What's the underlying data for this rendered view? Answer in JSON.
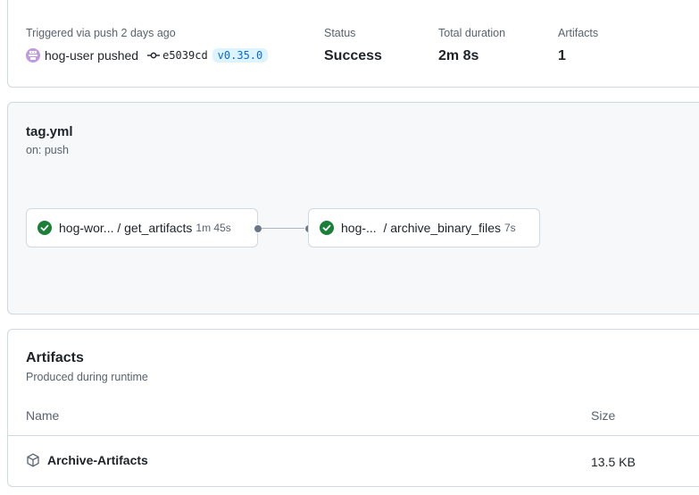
{
  "summary": {
    "trigger_label": "Triggered via push 2 days ago",
    "user": "hog-user",
    "action": "pushed",
    "commit_sha": "e5039cd",
    "tag": "v0.35.0",
    "status_label": "Status",
    "status_value": "Success",
    "duration_label": "Total duration",
    "duration_value": "2m 8s",
    "artifacts_label": "Artifacts",
    "artifacts_count": "1"
  },
  "workflow": {
    "file": "tag.yml",
    "trigger": "on: push",
    "jobs": [
      {
        "name": "hog-wor... / get_artifacts",
        "duration": "1m 45s",
        "status": "success"
      },
      {
        "name": "hog-...  / archive_binary_files",
        "duration": "7s",
        "status": "success"
      }
    ]
  },
  "artifacts": {
    "title": "Artifacts",
    "subtitle": "Produced during runtime",
    "columns": [
      "Name",
      "Size"
    ],
    "rows": [
      {
        "name": "Archive-Artifacts",
        "size": "13.5 KB",
        "icon": "package-icon"
      }
    ]
  },
  "colors": {
    "success": "#1a7f37",
    "tag_bg": "#ddf4ff",
    "tag_fg": "#0969da",
    "avatar": "#c297e3"
  }
}
